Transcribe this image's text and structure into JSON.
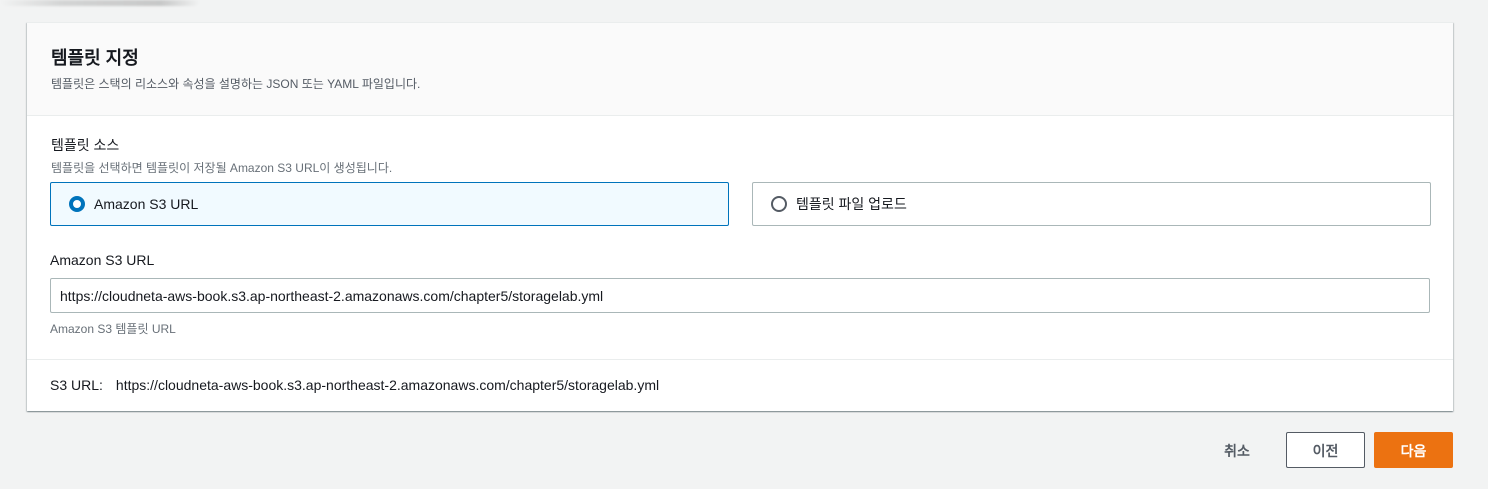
{
  "panel": {
    "title": "템플릿 지정",
    "description": "템플릿은 스택의 리소스와 속성을 설명하는 JSON 또는 YAML 파일입니다."
  },
  "template_source": {
    "label": "템플릿 소스",
    "description": "템플릿을 선택하면 템플릿이 저장될 Amazon S3 URL이 생성됩니다.",
    "options": [
      {
        "label": "Amazon S3 URL",
        "selected": true
      },
      {
        "label": "템플릿 파일 업로드",
        "selected": false
      }
    ]
  },
  "s3_url_field": {
    "label": "Amazon S3 URL",
    "value": "https://cloudneta-aws-book.s3.ap-northeast-2.amazonaws.com/chapter5/storagelab.yml",
    "hint": "Amazon S3 템플릿 URL"
  },
  "s3_url_summary": {
    "label": "S3 URL:",
    "value": "https://cloudneta-aws-book.s3.ap-northeast-2.amazonaws.com/chapter5/storagelab.yml"
  },
  "actions": {
    "cancel": "취소",
    "previous": "이전",
    "next": "다음"
  },
  "colors": {
    "accent": "#0073bb",
    "primary_button": "#ec7211",
    "background": "#f2f3f3"
  }
}
